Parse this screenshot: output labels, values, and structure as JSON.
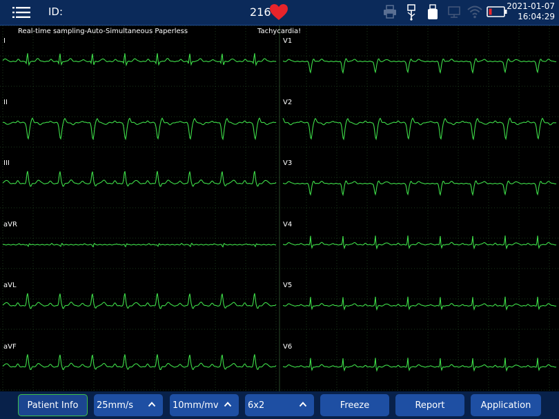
{
  "header": {
    "id_label": "ID:",
    "heart_rate": "216",
    "date": "2021-01-07",
    "time": "16:04:29"
  },
  "icons": [
    "menu-icon",
    "heart-icon",
    "printer-icon",
    "usb-icon",
    "usb-drive-icon",
    "network-icon",
    "wifi-icon",
    "battery-icon"
  ],
  "ecg": {
    "mode_text": "Real-time sampling-Auto-Simultaneous Paperless",
    "alert_text": "Tachycardia!",
    "left_leads": [
      "I",
      "II",
      "III",
      "aVR",
      "aVL",
      "aVF"
    ],
    "right_leads": [
      "V1",
      "V2",
      "V3",
      "V4",
      "V5",
      "V6"
    ]
  },
  "toolbar": {
    "patient_info": "Patient Info",
    "speed": "25mm/s",
    "gain": "10mm/mv",
    "layout": "6x2",
    "freeze": "Freeze",
    "report": "Report",
    "application": "Application"
  },
  "colors": {
    "trace": "#3fe04a",
    "grid": "#1d3a1d",
    "header_bg": "#0b2a5a",
    "button": "#1e4fa3",
    "heart": "#e8242b"
  }
}
